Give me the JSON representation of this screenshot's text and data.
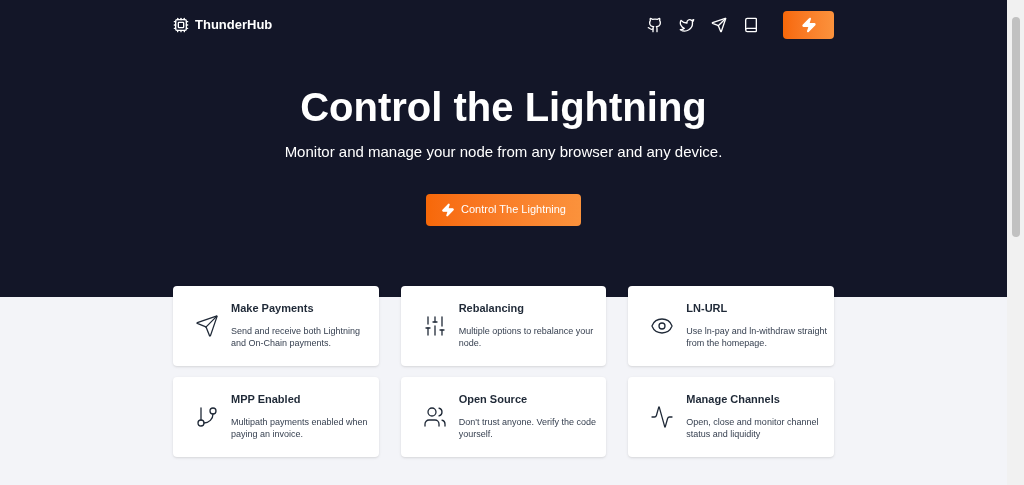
{
  "brand": "ThunderHub",
  "hero": {
    "title": "Control the Lightning",
    "subtitle": "Monitor and manage your node from any browser and any device.",
    "button": "Control The Lightning"
  },
  "features": [
    {
      "title": "Make Payments",
      "text": "Send and receive both Lightning and On-Chain payments."
    },
    {
      "title": "Rebalancing",
      "text": "Multiple options to rebalance your node."
    },
    {
      "title": "LN-URL",
      "text": "Use ln-pay and ln-withdraw straight from the homepage."
    },
    {
      "title": "MPP Enabled",
      "text": "Multipath payments enabled when paying an invoice."
    },
    {
      "title": "Open Source",
      "text": "Don't trust anyone. Verify the code yourself."
    },
    {
      "title": "Manage Channels",
      "text": "Open, close and monitor channel status and liquidity"
    }
  ]
}
